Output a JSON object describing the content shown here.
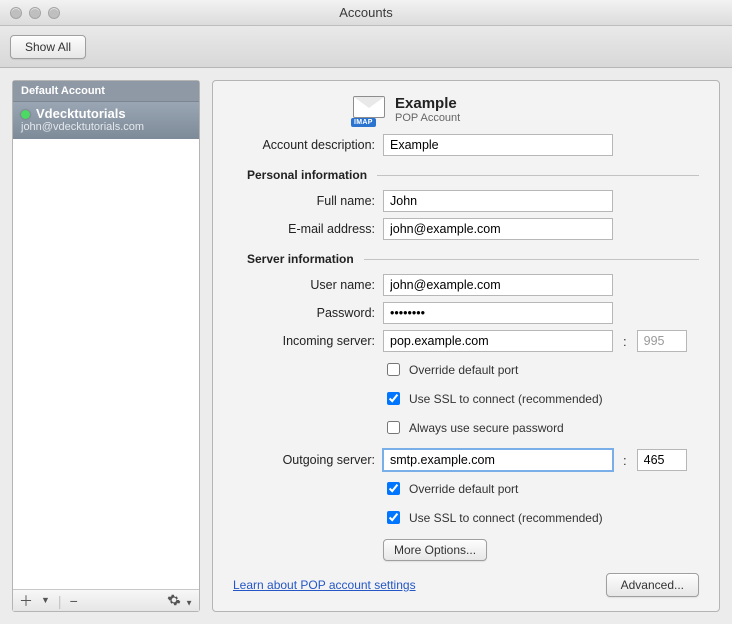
{
  "window": {
    "title": "Accounts"
  },
  "toolbar": {
    "show_all": "Show All"
  },
  "sidebar": {
    "section_label": "Default Account",
    "account": {
      "name": "Vdecktutorials",
      "email": "john@vdecktutorials.com"
    }
  },
  "header": {
    "title": "Example",
    "subtitle": "POP Account"
  },
  "labels": {
    "account_description": "Account description:",
    "personal_info": "Personal information",
    "full_name": "Full name:",
    "email_address": "E-mail address:",
    "server_info": "Server information",
    "user_name": "User name:",
    "password": "Password:",
    "incoming_server": "Incoming server:",
    "outgoing_server": "Outgoing server:",
    "override_port": "Override default port",
    "use_ssl": "Use SSL to connect (recommended)",
    "secure_password": "Always use secure password",
    "more_options": "More Options...",
    "learn_link": "Learn about POP account settings",
    "advanced": "Advanced..."
  },
  "values": {
    "account_description": "Example",
    "full_name": "John",
    "email_address": "john@example.com",
    "user_name": "john@example.com",
    "password": "••••••••",
    "incoming_server": "pop.example.com",
    "incoming_port": "995",
    "incoming_override": false,
    "incoming_ssl": true,
    "incoming_secure_pw": false,
    "outgoing_server": "smtp.example.com",
    "outgoing_port": "465",
    "outgoing_override": true,
    "outgoing_ssl": true
  }
}
